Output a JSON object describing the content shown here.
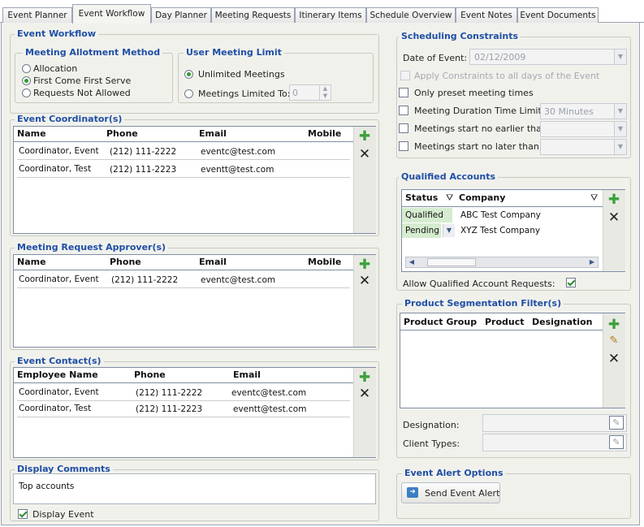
{
  "tabs": [
    "Event Planner",
    "Event Workflow",
    "Day Planner",
    "Meeting Requests",
    "Itinerary Items",
    "Schedule Overview",
    "Event Notes",
    "Event Documents"
  ],
  "event_workflow": {
    "title": "Event Workflow",
    "allotment": {
      "title": "Meeting Allotment Method",
      "options": [
        "Allocation",
        "First Come First Serve",
        "Requests Not Allowed"
      ],
      "selected": "First Come First Serve"
    },
    "limit": {
      "title": "User Meeting Limit",
      "unlimited_label": "Unlimited Meetings",
      "limited_label": "Meetings Limited To:",
      "limited_value": "0",
      "selected": "Unlimited Meetings"
    }
  },
  "coordinators": {
    "title": "Event Coordinator(s)",
    "columns": [
      "Name",
      "Phone",
      "Email",
      "Mobile"
    ],
    "rows": [
      {
        "name": "Coordinator, Event",
        "phone": "(212) 111-2222",
        "email": "eventc@test.com",
        "mobile": ""
      },
      {
        "name": "Coordinator, Test",
        "phone": "(212) 111-2223",
        "email": "eventt@test.com",
        "mobile": ""
      }
    ]
  },
  "approvers": {
    "title": "Meeting Request Approver(s)",
    "columns": [
      "Name",
      "Phone",
      "Email",
      "Mobile"
    ],
    "rows": [
      {
        "name": "Coordinator, Event",
        "phone": "(212) 111-2222",
        "email": "eventc@test.com",
        "mobile": ""
      }
    ]
  },
  "contacts": {
    "title": "Event Contact(s)",
    "columns": [
      "Employee Name",
      "Phone",
      "Email"
    ],
    "rows": [
      {
        "name": "Coordinator, Event",
        "phone": "(212) 111-2222",
        "email": "eventc@test.com"
      },
      {
        "name": "Coordinator, Test",
        "phone": "(212) 111-2223",
        "email": "eventt@test.com"
      }
    ]
  },
  "comments": {
    "title": "Display Comments",
    "text": "Top accounts",
    "display_event_label": "Display Event",
    "display_event_checked": true
  },
  "scheduling": {
    "title": "Scheduling Constraints",
    "date_label": "Date of Event:",
    "date_value": "02/12/2009",
    "apply_all_label": "Apply Constraints to all days of the Event",
    "preset_label": "Only preset meeting times",
    "duration_label": "Meeting Duration Time Limit:",
    "duration_value": "30 Minutes",
    "earliest_label": "Meetings start no earlier than:",
    "latest_label": "Meetings start no later than:"
  },
  "qualified": {
    "title": "Qualified Accounts",
    "columns": [
      "Status",
      "Company"
    ],
    "rows": [
      {
        "status": "Qualified",
        "company": "ABC Test Company"
      },
      {
        "status": "Pending",
        "company": "XYZ Test Company"
      }
    ],
    "allow_label": "Allow Qualified Account Requests:",
    "allow_checked": true,
    "status_color": "#d6ecd0"
  },
  "product_filter": {
    "title": "Product Segmentation Filter(s)",
    "columns": [
      "Product Group",
      "Product",
      "Designation"
    ],
    "designation_label": "Designation:",
    "client_types_label": "Client Types:"
  },
  "alert": {
    "title": "Event Alert Options",
    "send_label": "Send Event Alert"
  },
  "colors": {
    "accent": "#1f4fa6",
    "panel": "#f1f1ec",
    "add_icon": "#3aa23a"
  },
  "icons": [
    "add-icon",
    "delete-icon",
    "edit-icon",
    "filter-icon",
    "send-alert-icon",
    "dropdown-icon"
  ]
}
